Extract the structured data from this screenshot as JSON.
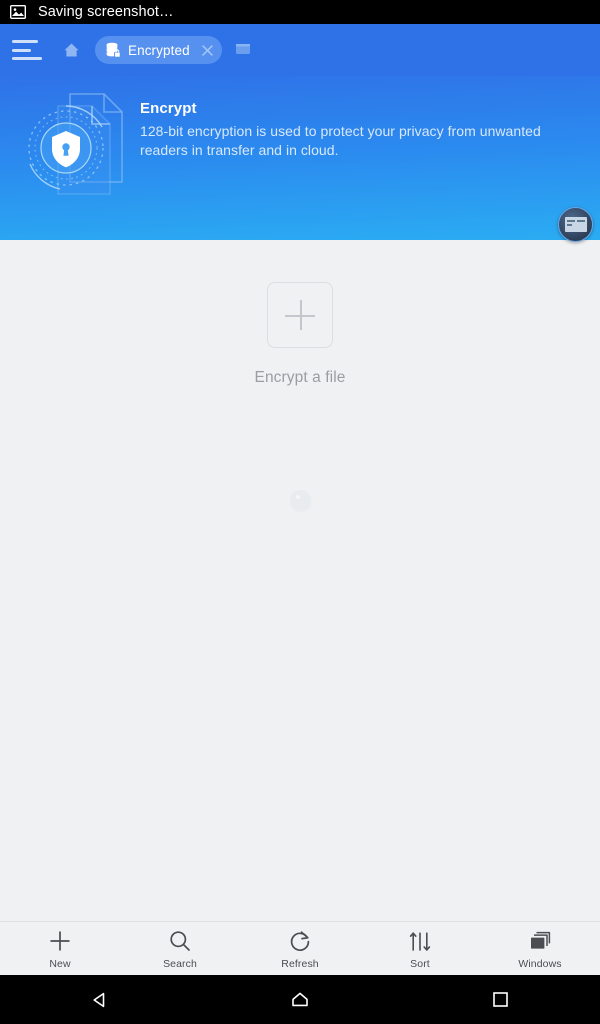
{
  "statusbar": {
    "icon": "image-icon",
    "text": "Saving screenshot…"
  },
  "toolbar": {
    "menu_icon": "hamburger-menu-icon",
    "home_icon": "home-icon",
    "tab": {
      "icon": "encrypted-database-icon",
      "label": "Encrypted",
      "close_icon": "close-icon"
    },
    "new_tab_icon": "new-window-icon"
  },
  "banner": {
    "illustration": "encrypted-documents-shield-illustration",
    "title": "Encrypt",
    "description": "128-bit encryption is used to protect your privacy from unwanted readers in transfer and in cloud.",
    "bg_gradient_from": "#2f72e8",
    "bg_gradient_to": "#2bacf2"
  },
  "floating_widget": {
    "name": "floating-overlay-button"
  },
  "content": {
    "add_icon": "plus-icon",
    "empty_label": "Encrypt a file",
    "empty_label_color": "#9a9da2",
    "background": "#f0f1f3",
    "spinner": "loading-spinner"
  },
  "bottombar": {
    "items": [
      {
        "icon": "plus-icon",
        "label": "New"
      },
      {
        "icon": "search-icon",
        "label": "Search"
      },
      {
        "icon": "refresh-icon",
        "label": "Refresh"
      },
      {
        "icon": "sort-icon",
        "label": "Sort"
      },
      {
        "icon": "windows-icon",
        "label": "Windows"
      }
    ]
  },
  "navbar": {
    "back_icon": "back-triangle-icon",
    "home_icon": "home-house-icon",
    "recents_icon": "recents-square-icon"
  }
}
